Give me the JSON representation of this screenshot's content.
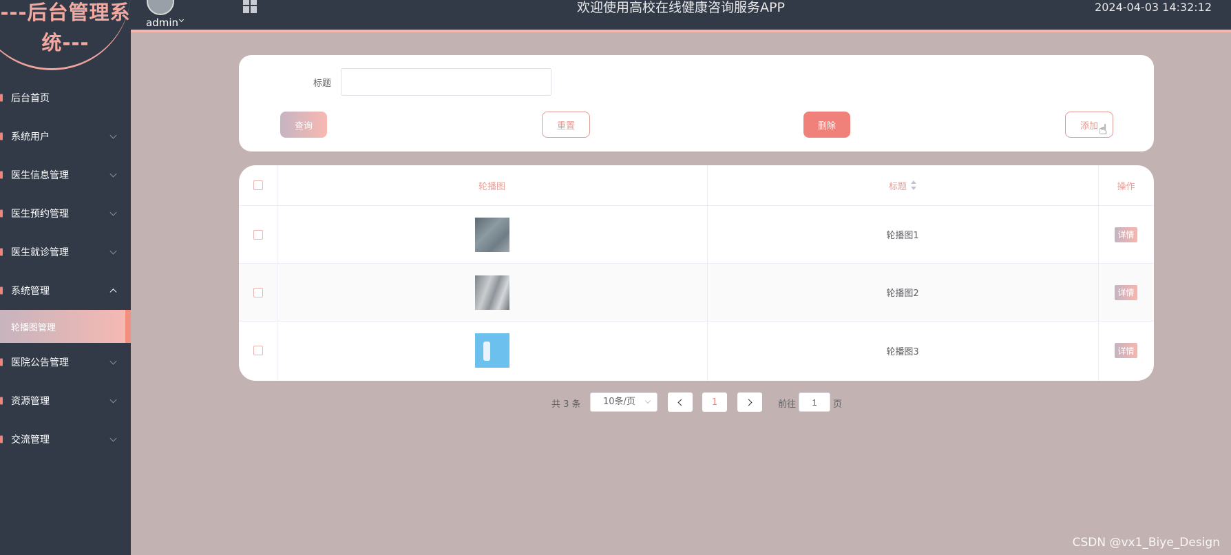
{
  "sidebar": {
    "logo": "---后台管理系统---",
    "items": [
      {
        "label": "后台首页"
      },
      {
        "label": "系统用户"
      },
      {
        "label": "医生信息管理"
      },
      {
        "label": "医生预约管理"
      },
      {
        "label": "医生就诊管理"
      },
      {
        "label": "系统管理"
      },
      {
        "label": "轮播图管理"
      },
      {
        "label": "医院公告管理"
      },
      {
        "label": "资源管理"
      },
      {
        "label": "交流管理"
      }
    ]
  },
  "header": {
    "user": "admin",
    "title": "欢迎使用高校在线健康咨询服务APP",
    "datetime": "2024-04-03 14:32:12"
  },
  "search": {
    "title_label": "标题",
    "title_value": "",
    "query_label": "查询",
    "reset_label": "重置",
    "delete_label": "删除",
    "add_label": "添加"
  },
  "table": {
    "headers": [
      "轮播图",
      "标题",
      "操作"
    ],
    "rows": [
      {
        "title": "轮播图1",
        "action": "详情"
      },
      {
        "title": "轮播图2",
        "action": "详情"
      },
      {
        "title": "轮播图3",
        "action": "详情"
      }
    ]
  },
  "pagination": {
    "total": "共 3 条",
    "page_size": "10条/页",
    "current_page": "1",
    "goto_label": "前往",
    "goto_value": "1",
    "page_suffix": "页"
  },
  "watermark": "CSDN @vx1_Biye_Design"
}
